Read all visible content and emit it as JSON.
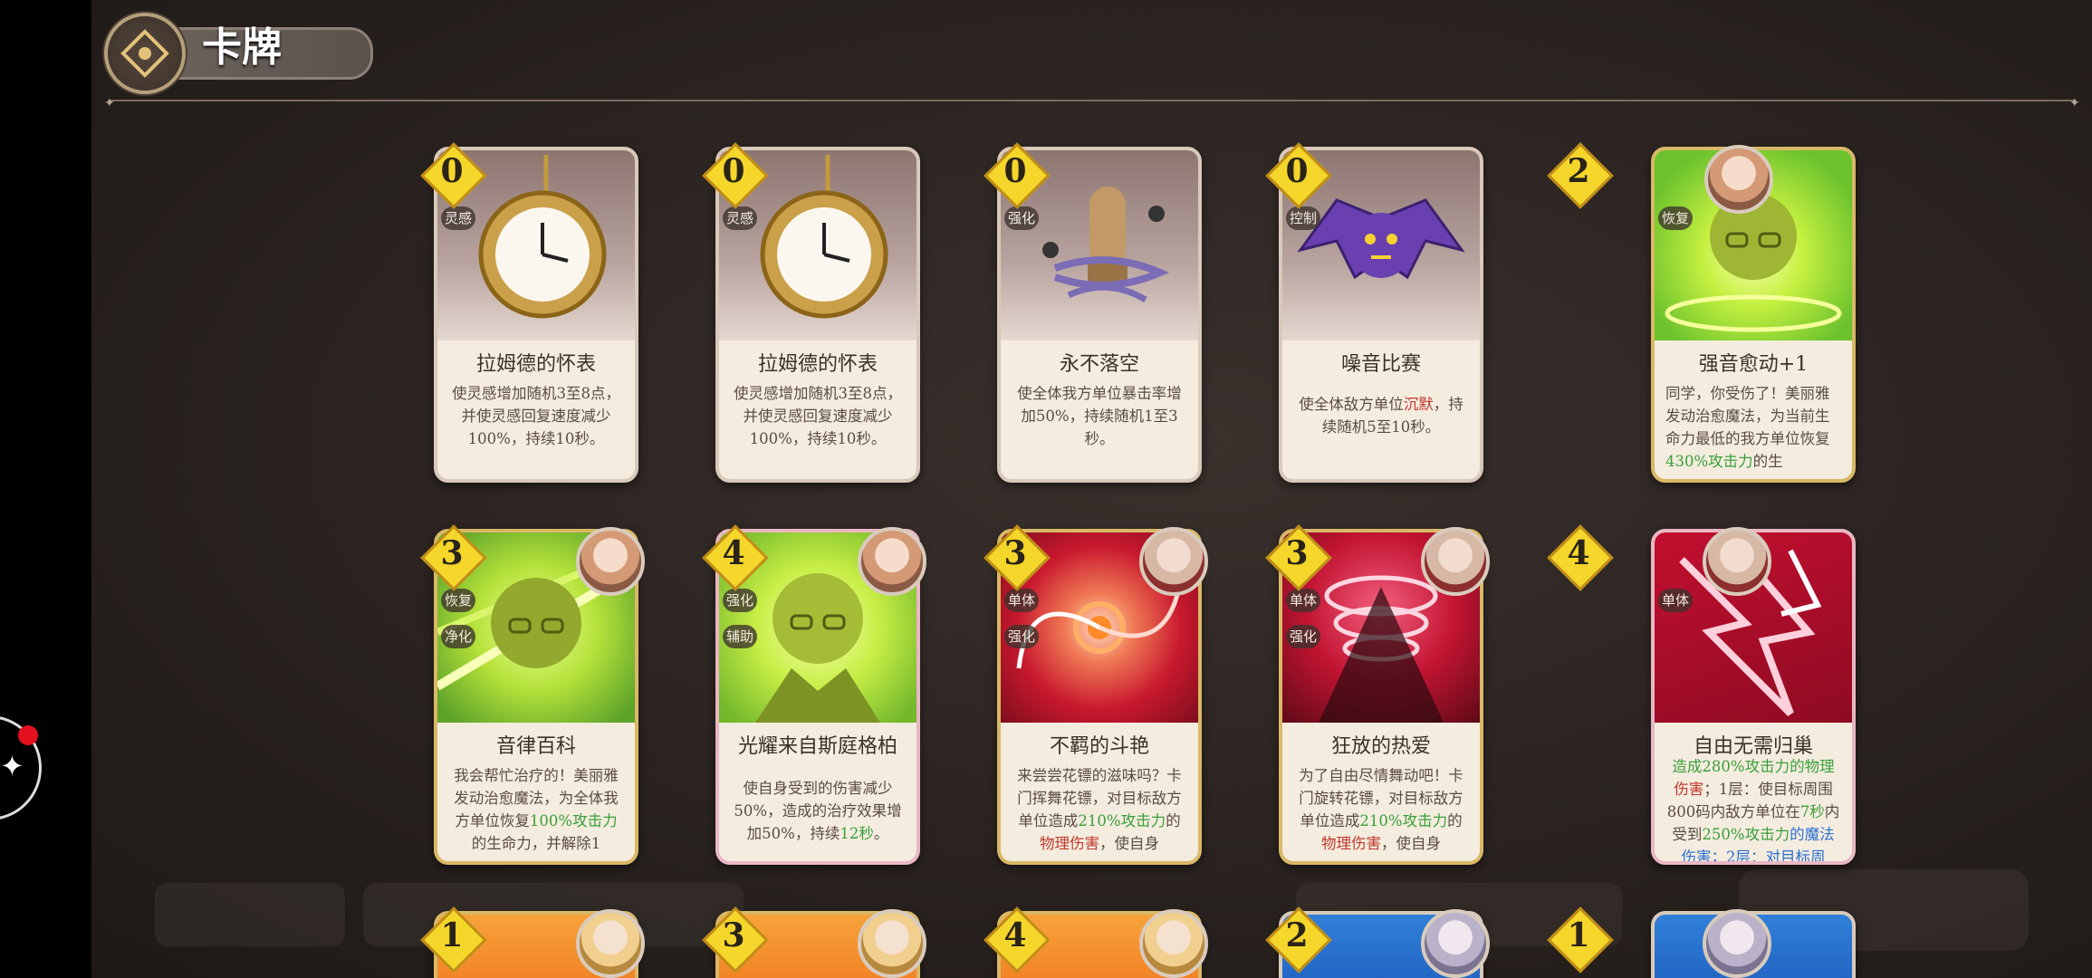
{
  "header": {
    "title": "卡牌"
  },
  "colors": {
    "cost_fill": "#f5d62b",
    "highlight_green": "#3a9f3a",
    "highlight_red": "#c0392b"
  },
  "cards_row1": [
    {
      "cost": "0",
      "name": "拉姆德的怀表",
      "tags": [
        "灵感"
      ],
      "desc": "使灵感增加随机3至8点，并使灵感回复速度减少100%，持续10秒。",
      "art": "pocket-watch"
    },
    {
      "cost": "0",
      "name": "拉姆德的怀表",
      "tags": [
        "灵感"
      ],
      "desc": "使灵感增加随机3至8点，并使灵感回复速度减少100%，持续10秒。",
      "art": "pocket-watch"
    },
    {
      "cost": "0",
      "name": "永不落空",
      "tags": [
        "强化"
      ],
      "desc": "使全体我方单位暴击率增加50%，持续随机1至3秒。",
      "art": "bullet"
    },
    {
      "cost": "0",
      "name": "噪音比赛",
      "tags": [
        "控制"
      ],
      "desc_a": "使全体敌方单位",
      "desc_hl": "沉默",
      "desc_b": "，持续随机5至10秒。",
      "art": "bat"
    },
    {
      "cost": "2",
      "name": "强音愈动+1",
      "tags": [
        "恢复"
      ],
      "desc_a": "同学，你受伤了！美丽雅发动治愈魔法，为当前生命力最低的我方单位恢复",
      "desc_hl": "430%攻击力",
      "desc_b": "的生",
      "art": "green-heal"
    }
  ],
  "cards_row2": [
    {
      "cost": "3",
      "name": "音律百科",
      "tags": [
        "恢复",
        "净化"
      ],
      "desc_a": "我会帮忙治疗的！美丽雅发动治愈魔法，为全体我方单位恢复",
      "desc_hl": "100%攻击力",
      "desc_b": "的生命力，并解除1",
      "art": "green-heal"
    },
    {
      "cost": "4",
      "name": "光耀来自斯庭格柏",
      "tags": [
        "强化",
        "辅助"
      ],
      "desc_a": "使自身受到的伤害减少50%，造成的治疗效果增加50%，持续",
      "desc_hl": "12秒",
      "desc_b": "。",
      "art": "green-buff"
    },
    {
      "cost": "3",
      "name": "不羁的斗艳",
      "tags": [
        "单体",
        "强化"
      ],
      "desc_a": "来尝尝花镖的滋味吗？卡门挥舞花镖，对目标敌方单位造成",
      "desc_hl": "210%攻击力",
      "desc_mid": "的",
      "desc_hl2": "物理伤害",
      "desc_b": "，使自身",
      "art": "red-spiral"
    },
    {
      "cost": "3",
      "name": "狂放的热爱",
      "tags": [
        "单体",
        "强化"
      ],
      "desc_a": "为了自由尽情舞动吧！卡门旋转花镖，对目标敌方单位造成",
      "desc_hl": "210%攻击力",
      "desc_mid": "的",
      "desc_hl2": "物理伤害",
      "desc_b": "，使自身",
      "art": "red-spin"
    },
    {
      "cost": "4",
      "name": "自由无需归巢",
      "tags": [
        "单体"
      ],
      "desc_top": "造成280%攻击力的物理",
      "desc_hl2": "伤害",
      "desc_a": "；1层：使目标周围800码内敌方单位在",
      "desc_hl": "7秒",
      "desc_mid": "内受到",
      "desc_hl3": "250%攻击力",
      "desc_b": "的魔法伤害；2层：对目标周",
      "art": "red-slash"
    }
  ],
  "cards_row3": [
    {
      "cost": "1",
      "art": "orange"
    },
    {
      "cost": "3",
      "art": "orange"
    },
    {
      "cost": "4",
      "art": "orange"
    },
    {
      "cost": "2",
      "art": "blue"
    },
    {
      "cost": "1",
      "art": "blue"
    }
  ]
}
